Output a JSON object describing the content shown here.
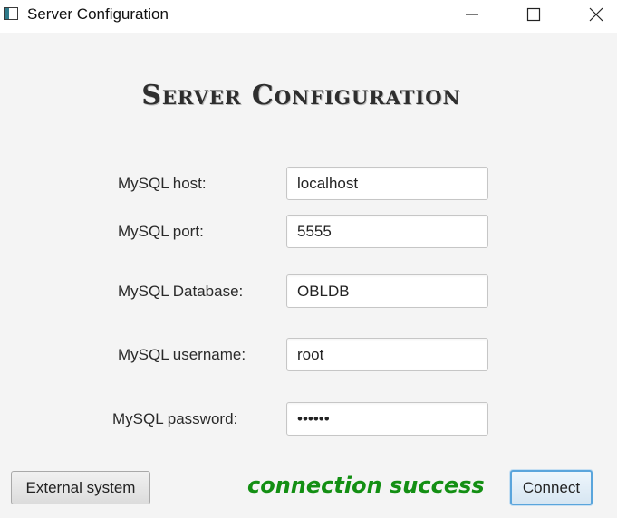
{
  "window": {
    "title": "Server Configuration",
    "minimize_icon": "minimize-icon",
    "maximize_icon": "maximize-icon",
    "close_icon": "close-icon"
  },
  "form": {
    "heading": "Server Configuration",
    "fields": [
      {
        "label": "MySQL host:",
        "value": "localhost"
      },
      {
        "label": "MySQL port:",
        "value": "5555"
      },
      {
        "label": "MySQL Database:",
        "value": "OBLDB"
      },
      {
        "label": "MySQL username:",
        "value": "root"
      },
      {
        "label": "MySQL password:",
        "value": "••••••"
      }
    ]
  },
  "footer": {
    "external_label": "External system",
    "status_text": "connection success",
    "status_color": "#138f13",
    "connect_label": "Connect"
  },
  "colors": {
    "accent": "#5aa5dc",
    "background": "#f4f4f4"
  }
}
